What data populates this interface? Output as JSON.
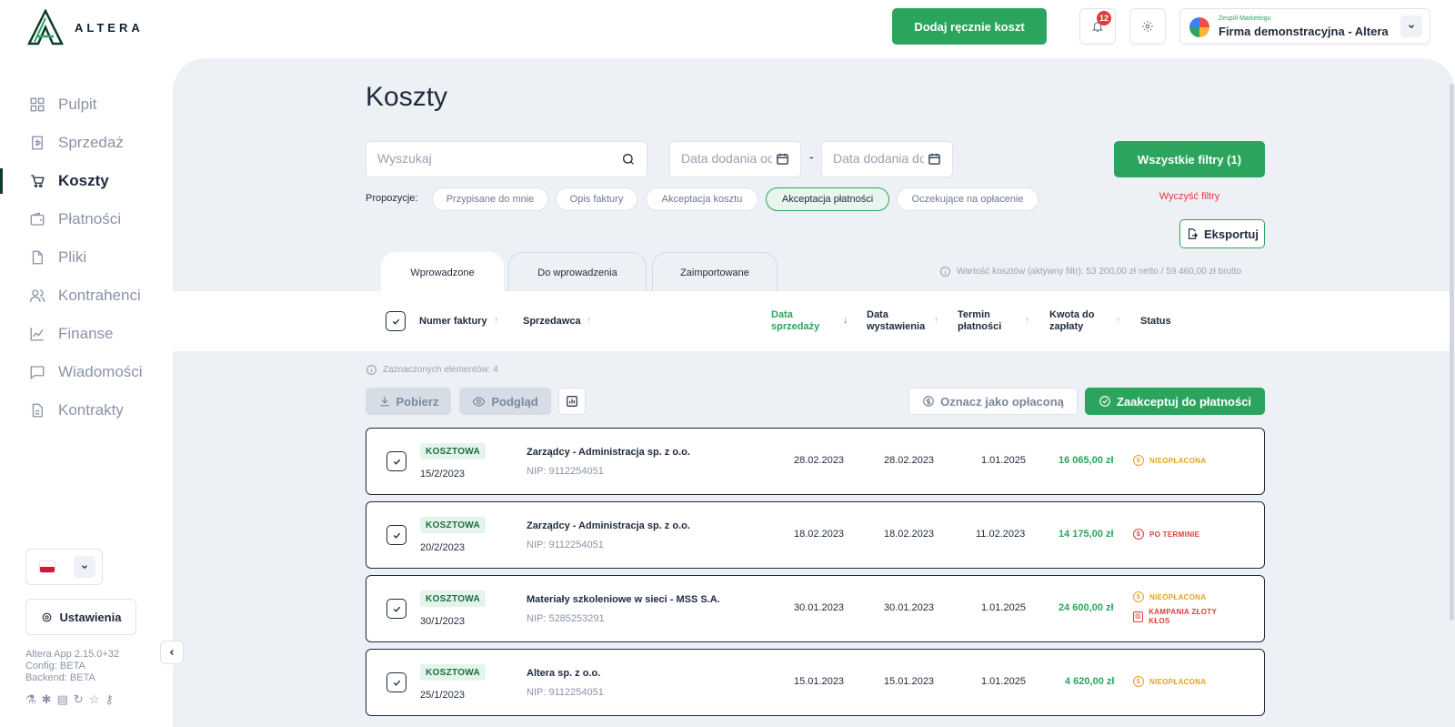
{
  "app": {
    "logo_text": "ALTERA",
    "add_cost_button": "Dodaj ręcznie koszt",
    "notifications_count": "12",
    "company_team": "Zespół Marketingu",
    "company_name": "Firma demonstracyjna - Altera",
    "accent_color": "#2ba55d",
    "danger_color": "#e23b3b",
    "warning_color": "#e5a224"
  },
  "sidebar": {
    "items": [
      {
        "label": "Pulpit",
        "icon": "dashboard-icon"
      },
      {
        "label": "Sprzedaż",
        "icon": "sales-icon"
      },
      {
        "label": "Koszty",
        "icon": "cart-icon",
        "active": true
      },
      {
        "label": "Płatności",
        "icon": "wallet-icon"
      },
      {
        "label": "Pliki",
        "icon": "file-icon"
      },
      {
        "label": "Kontrahenci",
        "icon": "users-icon"
      },
      {
        "label": "Finanse",
        "icon": "chart-icon"
      },
      {
        "label": "Wiadomości",
        "icon": "message-icon"
      },
      {
        "label": "Kontrakty",
        "icon": "contract-icon"
      }
    ],
    "settings_label": "Ustawienia",
    "version_line1": "Altera App 2.15.0+32",
    "version_line2": "Config: BETA",
    "version_line3": "Backend: BETA"
  },
  "main": {
    "title": "Koszty",
    "search_placeholder": "Wyszukaj",
    "date_from_placeholder": "Data dodania od",
    "date_to_placeholder": "Data dodania do",
    "date_separator": "-",
    "all_filters_label": "Wszystkie filtry (1)",
    "clear_filters_label": "Wyczyść filtry",
    "export_label": "Eksportuj",
    "proposals_label": "Propozycje:",
    "chips": [
      "Przypisane do mnie",
      "Opis faktury",
      "Akceptacja kosztu",
      "Akceptacja płatności",
      "Oczekujące na opłacenie"
    ],
    "active_chip": "Akceptacja płatności",
    "tabs": [
      "Wprowadzone",
      "Do wprowadzenia",
      "Zaimportowane"
    ],
    "active_tab": "Wprowadzone",
    "total_info": "Wartość kosztów (aktywny filtr): 53 200,00 zł netto / 59 460,00 zł brutto"
  },
  "table": {
    "headers": {
      "invoice_number": "Numer faktury",
      "seller": "Sprzedawca",
      "sale_date_1": "Data",
      "sale_date_2": "sprzedaży",
      "issue_date_1": "Data",
      "issue_date_2": "wystawienia",
      "due_date_1": "Termin",
      "due_date_2": "płatności",
      "amount_1": "Kwota do",
      "amount_2": "zapłaty",
      "status": "Status"
    },
    "sorted_by": "sale_date",
    "selected_info": "Zaznaczonych elementów: 4",
    "actions": {
      "download": "Pobierz",
      "preview": "Podgląd",
      "mark_paid": "Oznacz jako opłaconą",
      "accept_payment": "Zaakceptuj do płatności"
    },
    "rows": [
      {
        "type": "KOSZTOWA",
        "number": "15/2/2023",
        "seller": "Zarządcy - Administracja sp. z o.o.",
        "nip": "NIP: 9112254051",
        "sale_date": "28.02.2023",
        "issue_date": "28.02.2023",
        "due_date": "1.01.2025",
        "amount": "16 065,00 zł",
        "status1": "NIEOPŁACONA",
        "status2": ""
      },
      {
        "type": "KOSZTOWA",
        "number": "20/2/2023",
        "seller": "Zarządcy - Administracja sp. z o.o.",
        "nip": "NIP: 9112254051",
        "sale_date": "18.02.2023",
        "issue_date": "18.02.2023",
        "due_date": "11.02.2023",
        "amount": "14 175,00 zł",
        "status1": "PO TERMINIE",
        "status2": ""
      },
      {
        "type": "KOSZTOWA",
        "number": "30/1/2023",
        "seller": "Materiały szkoleniowe w sieci - MSS S.A.",
        "nip": "NIP: 5285253291",
        "sale_date": "30.01.2023",
        "issue_date": "30.01.2023",
        "due_date": "1.01.2025",
        "amount": "24 600,00 zł",
        "status1": "NIEOPŁACONA",
        "status2": "KAMPANIA ZŁOTY KŁOS"
      },
      {
        "type": "KOSZTOWA",
        "number": "25/1/2023",
        "seller": "Altera sp. z o.o.",
        "nip": "NIP: 9112254051",
        "sale_date": "15.01.2023",
        "issue_date": "15.01.2023",
        "due_date": "1.01.2025",
        "amount": "4 620,00 zł",
        "status1": "NIEOPŁACONA",
        "status2": ""
      }
    ]
  }
}
